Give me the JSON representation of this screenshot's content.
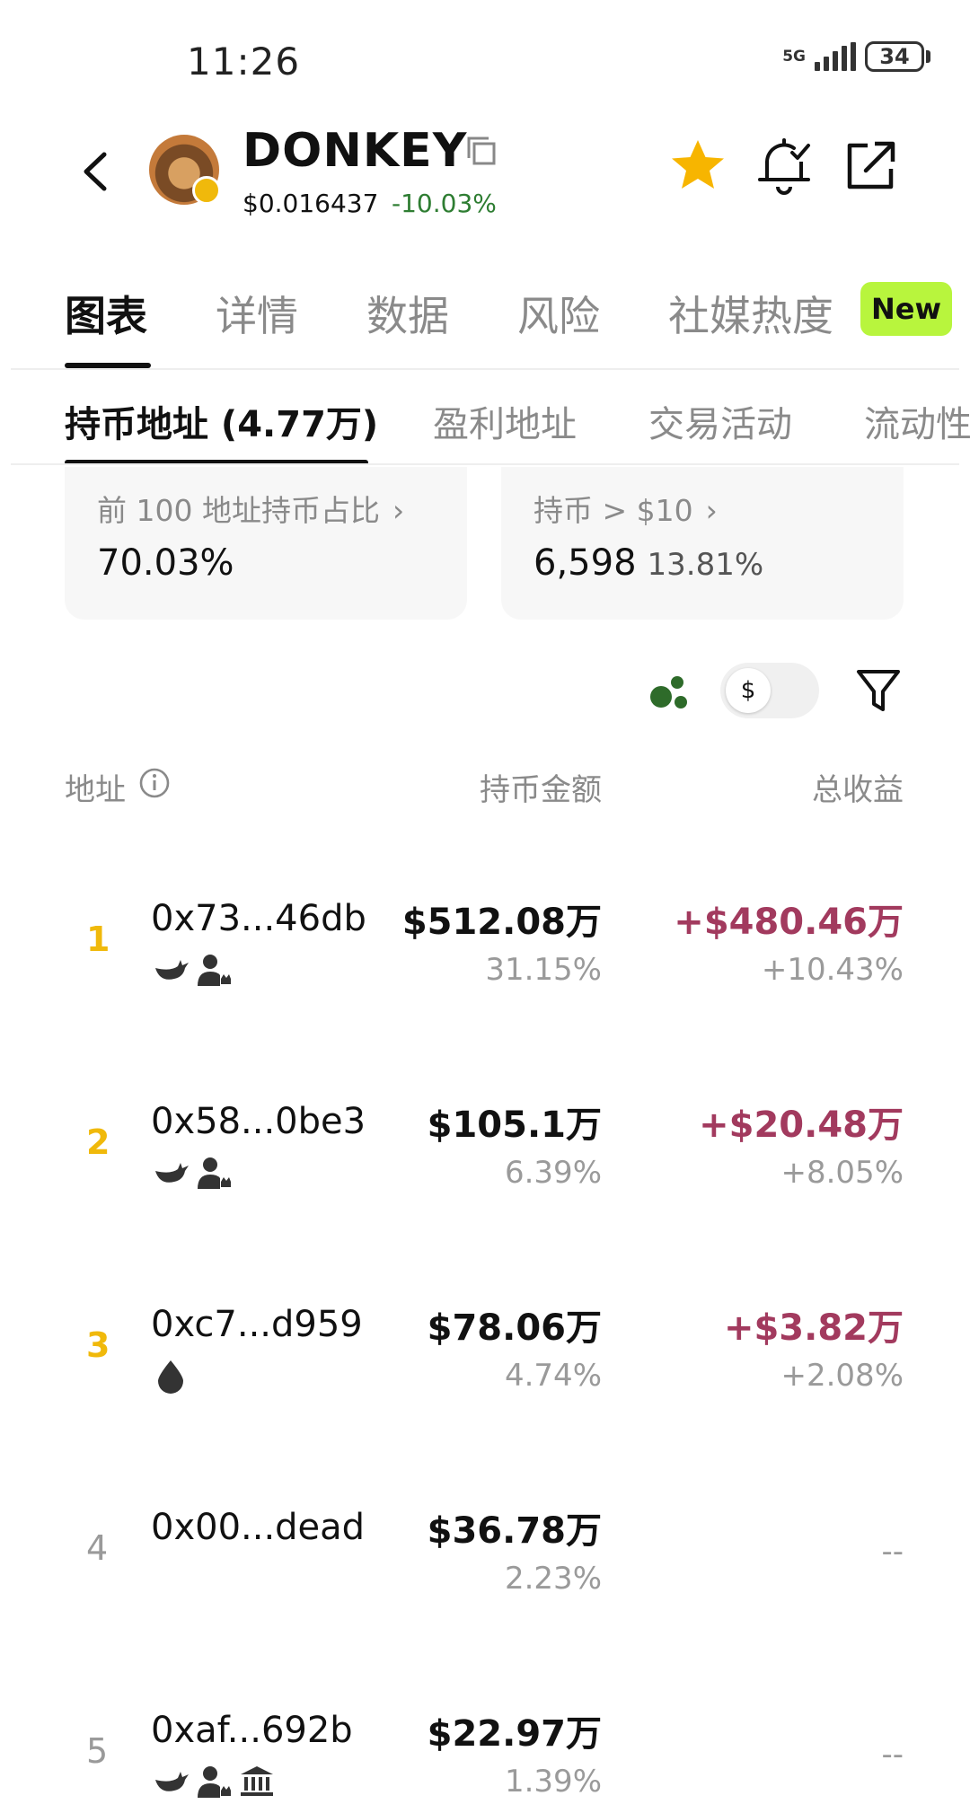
{
  "status_bar": {
    "time": "11:26",
    "network": "5G",
    "battery": "34"
  },
  "header": {
    "token_name": "DONKEY",
    "price": "$0.016437",
    "change": "-10.03%",
    "icons": [
      "back-icon",
      "copy-icon",
      "star-icon",
      "bell-icon",
      "share-icon"
    ],
    "favorite_color": "#f7b500"
  },
  "main_tabs": [
    {
      "label": "图表"
    },
    {
      "label": "详情"
    },
    {
      "label": "数据"
    },
    {
      "label": "风险"
    },
    {
      "label": "社媒热度"
    }
  ],
  "new_badge": "New",
  "sub_tabs": [
    {
      "label": "持币地址 (4.77万)"
    },
    {
      "label": "盈利地址"
    },
    {
      "label": "交易活动"
    },
    {
      "label": "流动性"
    }
  ],
  "cards": [
    {
      "label": "前 100 地址持币占比",
      "value": "70.03%",
      "sub": ""
    },
    {
      "label": "持币 > $10",
      "value": "6,598",
      "sub": "13.81%"
    }
  ],
  "toolbar": {
    "toggle_symbol": "$"
  },
  "columns": {
    "address": "地址",
    "amount": "持币金额",
    "pnl": "总收益"
  },
  "rows": [
    {
      "rank": "1",
      "address": "0x73...46db",
      "amount": "$512.08万",
      "amount_pct": "31.15%",
      "pnl": "+$480.46万",
      "pnl_pct": "+10.43%",
      "tags": [
        "whale-icon",
        "person-crown-icon"
      ]
    },
    {
      "rank": "2",
      "address": "0x58...0be3",
      "amount": "$105.1万",
      "amount_pct": "6.39%",
      "pnl": "+$20.48万",
      "pnl_pct": "+8.05%",
      "tags": [
        "whale-icon",
        "person-crown-icon"
      ]
    },
    {
      "rank": "3",
      "address": "0xc7...d959",
      "amount": "$78.06万",
      "amount_pct": "4.74%",
      "pnl": "+$3.82万",
      "pnl_pct": "+2.08%",
      "tags": [
        "drop-icon"
      ]
    },
    {
      "rank": "4",
      "address": "0x00...dead",
      "amount": "$36.78万",
      "amount_pct": "2.23%",
      "pnl": "--",
      "pnl_pct": "",
      "tags": []
    },
    {
      "rank": "5",
      "address": "0xaf...692b",
      "amount": "$22.97万",
      "amount_pct": "1.39%",
      "pnl": "--",
      "pnl_pct": "",
      "tags": [
        "whale-icon",
        "person-crown-icon",
        "bank-icon"
      ]
    }
  ],
  "colors": {
    "gain": "#a23a5e",
    "loss_change": "#2e7d32",
    "rank_top": "#f0b90b",
    "new_badge": "#b8f53d"
  }
}
